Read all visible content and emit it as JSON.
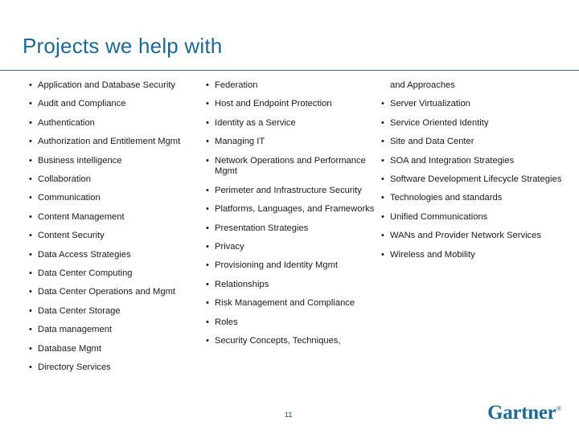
{
  "slide": {
    "title": "Projects we help with",
    "page_number": "11",
    "logo": "Gartner",
    "logo_mark": "®",
    "bullet_char": "•",
    "accent_color": "#1b6a96",
    "rule_color": "#2f6f91",
    "columns": [
      {
        "id": "column-1",
        "items": [
          "Application and Database Security",
          "Audit and Compliance",
          "Authentication",
          "Authorization and Entitlement Mgmt",
          "Business intelligence",
          "Collaboration",
          "Communication",
          "Content Management",
          "Content Security",
          "Data Access Strategies",
          "Data Center Computing",
          "Data Center Operations and Mgmt",
          "Data Center Storage",
          "Data management",
          "Database Mgmt",
          "Directory Services"
        ]
      },
      {
        "id": "column-2",
        "items": [
          "Federation",
          "Host and Endpoint Protection",
          "Identity as a Service",
          "Managing IT",
          "Network Operations and Performance Mgmt",
          "Perimeter and Infrastructure Security",
          "Platforms, Languages, and Frameworks",
          "Presentation Strategies",
          "Privacy",
          "Provisioning and Identity Mgmt",
          "Relationships",
          "Risk Management and Compliance",
          "Roles",
          "Security Concepts, Techniques,"
        ]
      },
      {
        "id": "column-3",
        "continuation": "and Approaches",
        "items": [
          "Server Virtualization",
          "Service Oriented Identity",
          "Site and Data Center",
          "SOA and Integration Strategies",
          "Software Development Lifecycle Strategies",
          "Technologies and standards",
          "Unified Communications",
          "WANs and Provider Network Services",
          "Wireless and Mobility"
        ]
      }
    ]
  }
}
